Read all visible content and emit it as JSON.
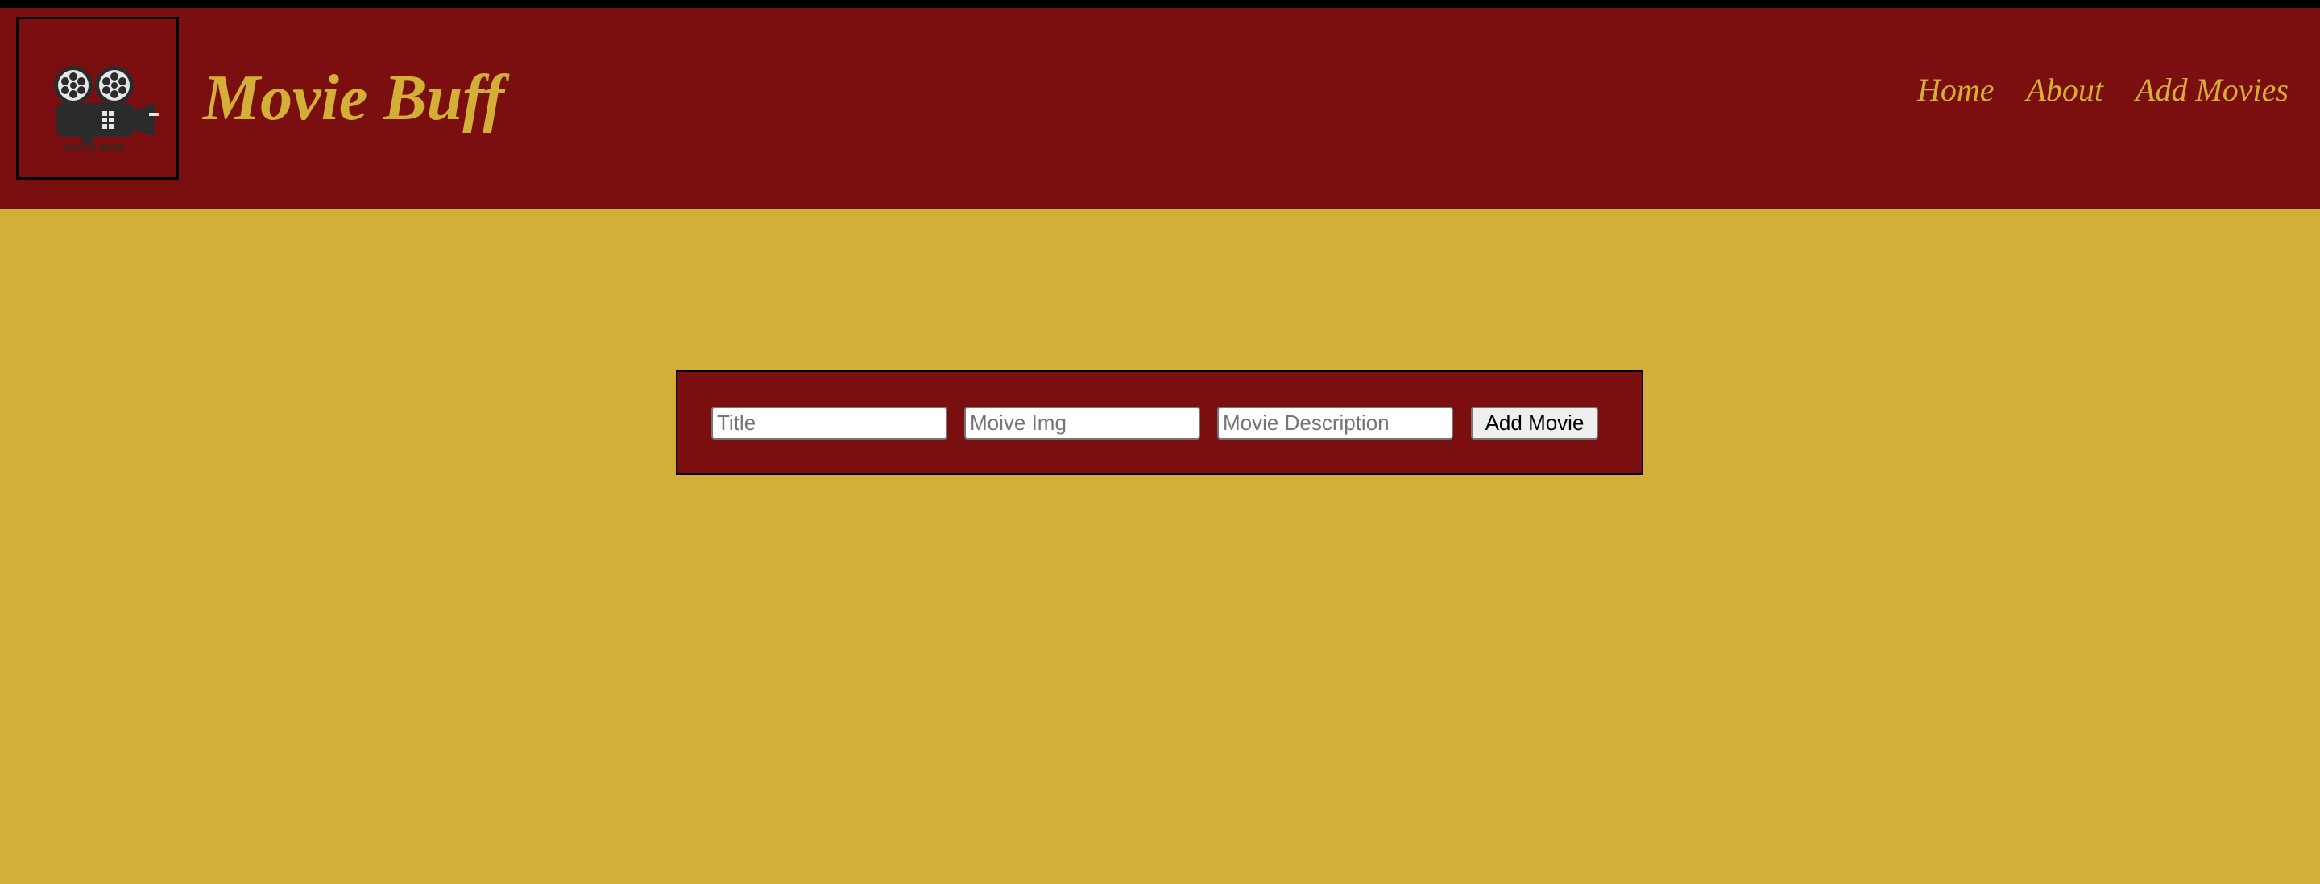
{
  "header": {
    "logo": {
      "icon": "movie-camera-icon",
      "caption": "MOVIE BUFF"
    },
    "title": "Movie Buff",
    "nav": [
      {
        "label": "Home"
      },
      {
        "label": "About"
      },
      {
        "label": "Add Movies"
      }
    ]
  },
  "form": {
    "title_placeholder": "Title",
    "img_placeholder": "Moive Img",
    "description_placeholder": "Movie Description",
    "submit_label": "Add Movie"
  },
  "colors": {
    "header_bg": "#7b0f0f",
    "page_bg": "#d4af37",
    "accent_text": "#d4af37",
    "top_strip": "#000000"
  }
}
